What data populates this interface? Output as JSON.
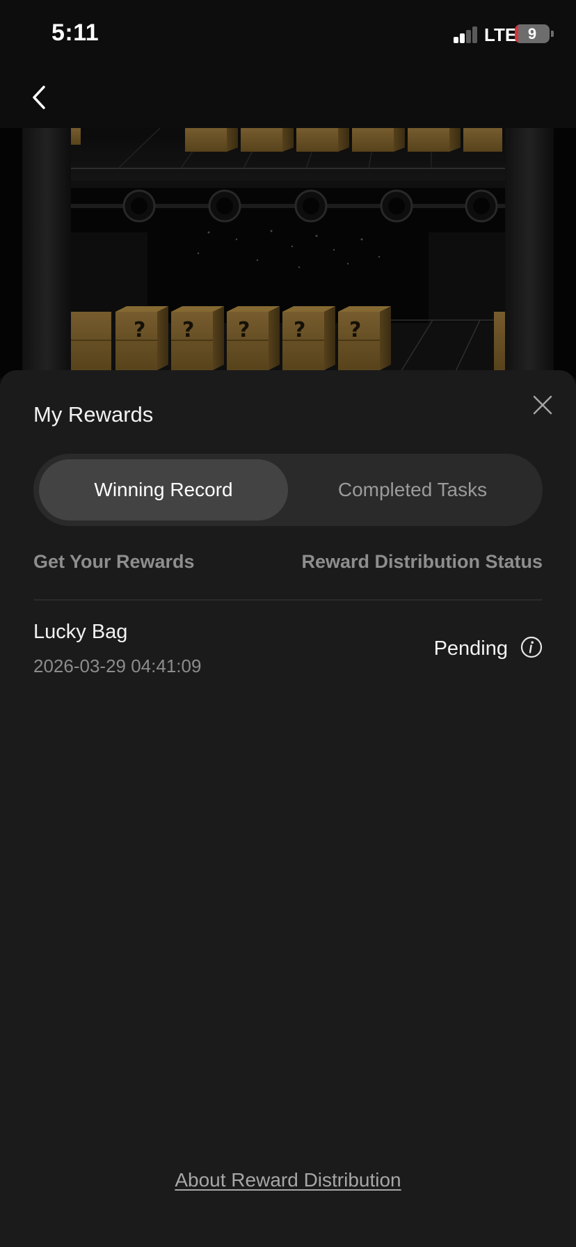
{
  "status_bar": {
    "time": "5:11",
    "network": "LTE",
    "battery": "9",
    "battery_level": 0.09,
    "battery_color": "#d8313a"
  },
  "header": {
    "back_icon": "chevron-left-icon"
  },
  "sheet": {
    "title": "My Rewards",
    "close_icon": "close-icon",
    "tabs": [
      {
        "label": "Winning Record",
        "active": true
      },
      {
        "label": "Completed Tasks",
        "active": false
      }
    ],
    "columns": {
      "left": "Get Your Rewards",
      "right": "Reward Distribution Status"
    },
    "records": [
      {
        "title": "Lucky Bag",
        "date": "2026-03-29 04:41:09",
        "status": "Pending",
        "status_icon": "info-icon"
      }
    ],
    "footer_link": "About Reward Distribution"
  },
  "colors": {
    "sheet_bg": "#1b1b1b",
    "active_tab": "#434343",
    "box": "#8a6a2c"
  }
}
